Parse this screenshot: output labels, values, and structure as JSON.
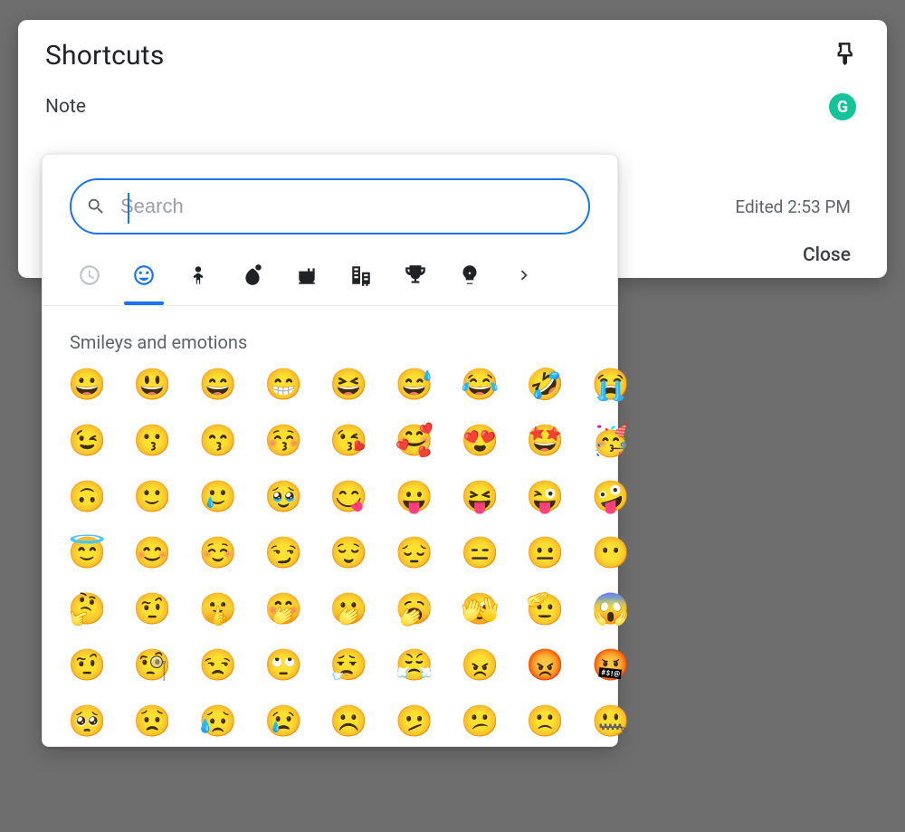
{
  "card": {
    "title": "Shortcuts",
    "note_label": "Note",
    "edited": "Edited 2:53 PM",
    "close": "Close",
    "grammarly_badge": "G"
  },
  "picker": {
    "search_placeholder": "Search",
    "section_title": "Smileys and emotions",
    "categories": [
      {
        "name": "recent",
        "label": "Recent"
      },
      {
        "name": "smileys",
        "label": "Smileys and emotions"
      },
      {
        "name": "people",
        "label": "People"
      },
      {
        "name": "nature",
        "label": "Animals and nature"
      },
      {
        "name": "food",
        "label": "Food and drink"
      },
      {
        "name": "travel",
        "label": "Travel and places"
      },
      {
        "name": "activity",
        "label": "Activities and events"
      },
      {
        "name": "objects",
        "label": "Objects"
      },
      {
        "name": "more",
        "label": "More"
      }
    ],
    "active_category": "smileys",
    "emojis": [
      "😀",
      "😃",
      "😄",
      "😁",
      "😆",
      "😅",
      "😂",
      "🤣",
      "😭",
      "😉",
      "😗",
      "😙",
      "😚",
      "😘",
      "🥰",
      "😍",
      "🤩",
      "🥳",
      "🙃",
      "🙂",
      "🥲",
      "🥹",
      "😋",
      "😛",
      "😝",
      "😜",
      "🤪",
      "😇",
      "😊",
      "☺️",
      "😏",
      "😌",
      "😔",
      "😑",
      "😐",
      "😶",
      "🤔",
      "🤨",
      "🤫",
      "🤭",
      "🫢",
      "🥱",
      "🫣",
      "🫡",
      "😱",
      "🤨",
      "🧐",
      "😒",
      "🙄",
      "😮‍💨",
      "😤",
      "😠",
      "😡",
      "🤬",
      "🥺",
      "😟",
      "😥",
      "😢",
      "☹️",
      "🫤",
      "😕",
      "🙁",
      "🤐"
    ]
  }
}
